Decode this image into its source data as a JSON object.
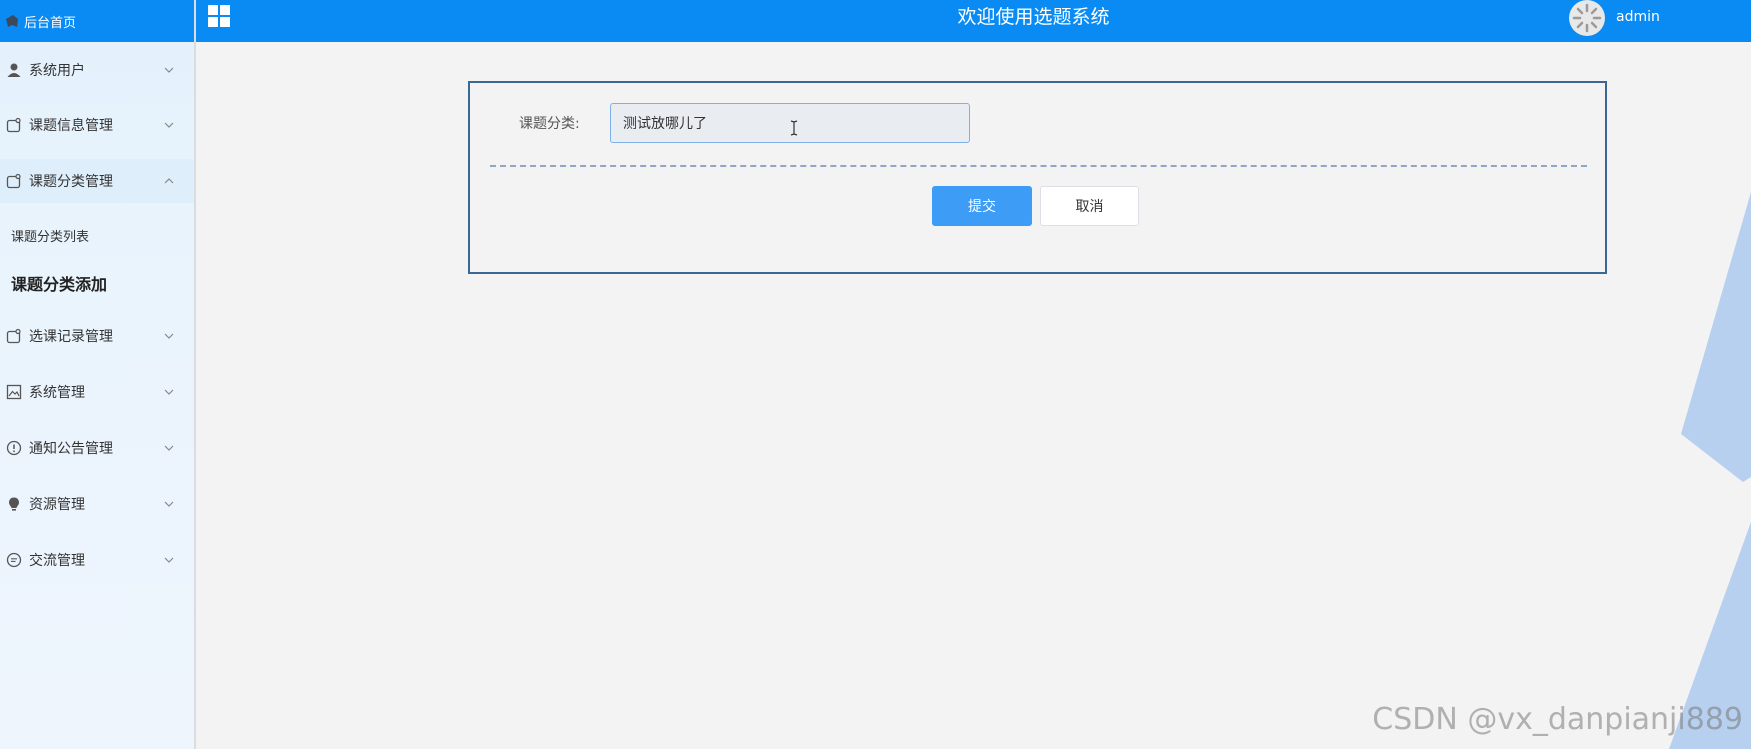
{
  "sidebar": {
    "home_label": "后台首页",
    "items": [
      {
        "label": "系统用户",
        "icon": "user-icon"
      },
      {
        "label": "课题信息管理",
        "icon": "tag-icon"
      },
      {
        "label": "课题分类管理",
        "icon": "tag-icon"
      },
      {
        "label": "选课记录管理",
        "icon": "tag-icon"
      },
      {
        "label": "系统管理",
        "icon": "picture-icon"
      },
      {
        "label": "通知公告管理",
        "icon": "info-icon"
      },
      {
        "label": "资源管理",
        "icon": "bulb-icon"
      },
      {
        "label": "交流管理",
        "icon": "chat-icon"
      }
    ],
    "subitems": [
      {
        "label": "课题分类列表"
      },
      {
        "label": "课题分类添加"
      }
    ]
  },
  "header": {
    "title": "欢迎使用选题系统",
    "user": "admin"
  },
  "form": {
    "label": "课题分类:",
    "value": "测试放哪儿了",
    "submit_label": "提交",
    "cancel_label": "取消"
  },
  "watermark": "CSDN @vx_danpianji889",
  "colors": {
    "topbar": "#0a8bf3",
    "primary_button": "#3d9cf6",
    "panel_border": "#3a6795",
    "decoration": "#b7d0ef"
  }
}
